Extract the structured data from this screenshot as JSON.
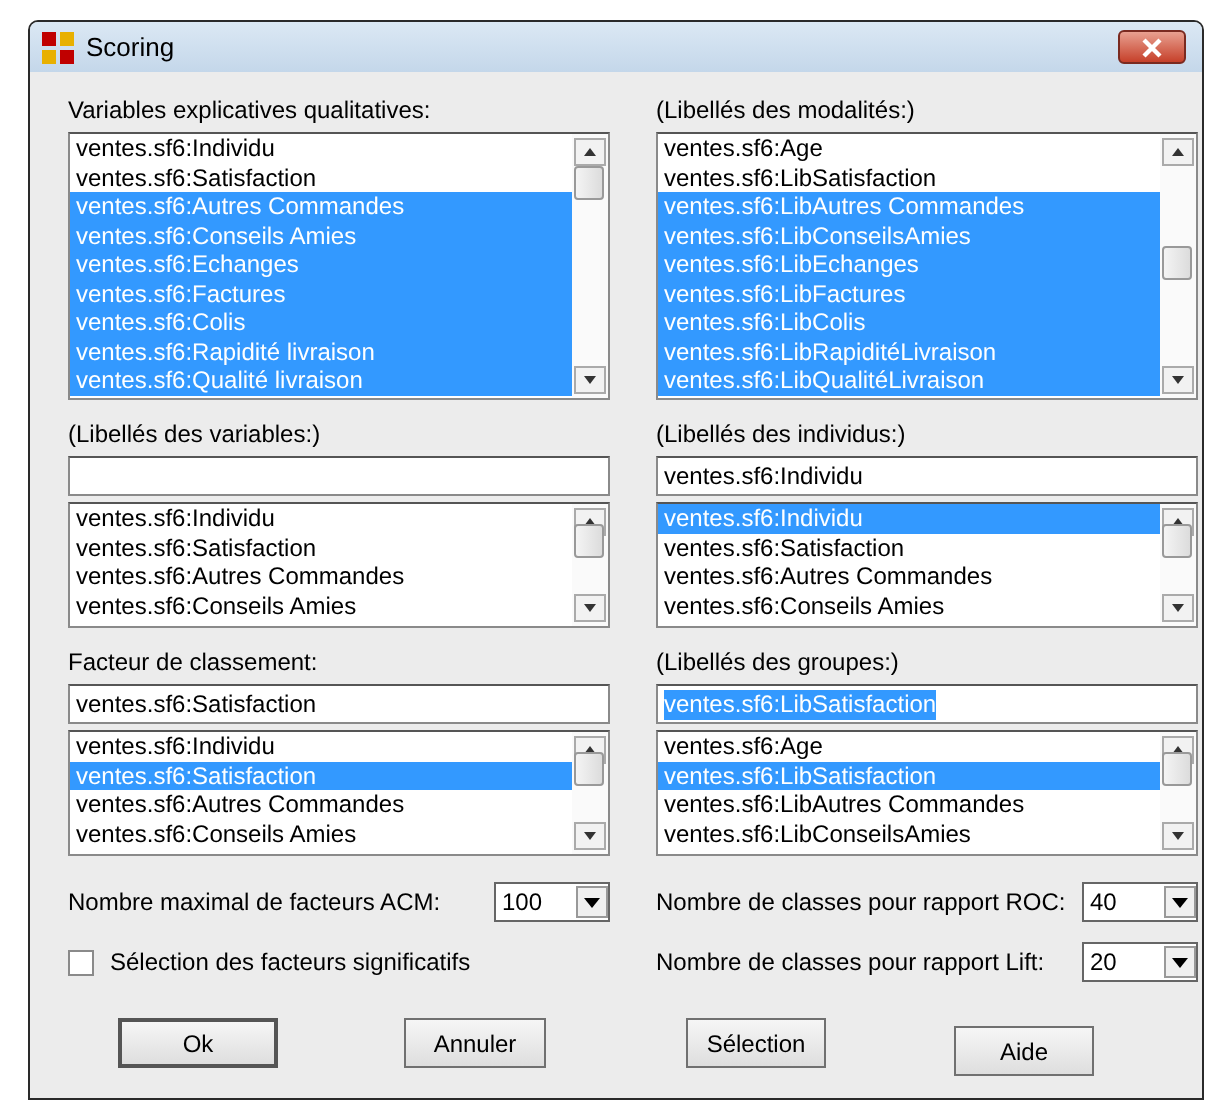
{
  "window": {
    "title": "Scoring"
  },
  "sections": [
    {
      "kind": "list",
      "label": "Variables explicatives qualitatives:",
      "items": [
        {
          "text": "ventes.sf6:Individu",
          "selected": false
        },
        {
          "text": "ventes.sf6:Satisfaction",
          "selected": false
        },
        {
          "text": "ventes.sf6:Autres Commandes",
          "selected": true
        },
        {
          "text": "ventes.sf6:Conseils Amies",
          "selected": true
        },
        {
          "text": "ventes.sf6:Echanges",
          "selected": true
        },
        {
          "text": "ventes.sf6:Factures",
          "selected": true
        },
        {
          "text": "ventes.sf6:Colis",
          "selected": true
        },
        {
          "text": "ventes.sf6:Rapidité livraison",
          "selected": true
        },
        {
          "text": "ventes.sf6:Qualité livraison",
          "selected": true
        }
      ]
    },
    {
      "kind": "list",
      "label": "(Libellés des modalités:)",
      "items": [
        {
          "text": "ventes.sf6:Age",
          "selected": false
        },
        {
          "text": "ventes.sf6:LibSatisfaction",
          "selected": false
        },
        {
          "text": "ventes.sf6:LibAutres Commandes",
          "selected": true
        },
        {
          "text": "ventes.sf6:LibConseilsAmies",
          "selected": true
        },
        {
          "text": "ventes.sf6:LibEchanges",
          "selected": true
        },
        {
          "text": "ventes.sf6:LibFactures",
          "selected": true
        },
        {
          "text": "ventes.sf6:LibColis",
          "selected": true
        },
        {
          "text": "ventes.sf6:LibRapiditéLivraison",
          "selected": true
        },
        {
          "text": "ventes.sf6:LibQualitéLivraison",
          "selected": true
        }
      ]
    },
    {
      "kind": "field-list",
      "label": "(Libellés des variables:)",
      "items": [
        {
          "text": "ventes.sf6:Individu",
          "selected": false
        },
        {
          "text": "ventes.sf6:Satisfaction",
          "selected": false
        },
        {
          "text": "ventes.sf6:Autres Commandes",
          "selected": false
        },
        {
          "text": "ventes.sf6:Conseils Amies",
          "selected": false
        }
      ]
    },
    {
      "kind": "field-list",
      "label": "(Libellés des individus:)",
      "field": {
        "value": "ventes.sf6:Individu",
        "value_selected": false
      },
      "items": [
        {
          "text": "ventes.sf6:Individu",
          "selected": true
        },
        {
          "text": "ventes.sf6:Satisfaction",
          "selected": false
        },
        {
          "text": "ventes.sf6:Autres Commandes",
          "selected": false
        },
        {
          "text": "ventes.sf6:Conseils Amies",
          "selected": false
        }
      ]
    },
    {
      "kind": "field-list",
      "label": "Facteur de classement:",
      "field": {
        "value": "ventes.sf6:Satisfaction",
        "value_selected": false
      },
      "items": [
        {
          "text": "ventes.sf6:Individu",
          "selected": false
        },
        {
          "text": "ventes.sf6:Satisfaction",
          "selected": true
        },
        {
          "text": "ventes.sf6:Autres Commandes",
          "selected": false
        },
        {
          "text": "ventes.sf6:Conseils Amies",
          "selected": false
        }
      ]
    },
    {
      "kind": "field-list",
      "label": "(Libellés des groupes:)",
      "field": {
        "value": "ventes.sf6:LibSatisfaction",
        "value_selected": true
      },
      "items": [
        {
          "text": "ventes.sf6:Age",
          "selected": false
        },
        {
          "text": "ventes.sf6:LibSatisfaction",
          "selected": true
        },
        {
          "text": "ventes.sf6:LibAutres Commandes",
          "selected": false
        },
        {
          "text": "ventes.sf6:LibConseilsAmies",
          "selected": false
        }
      ]
    }
  ],
  "options": [
    {
      "kind": "combo",
      "label": "Nombre maximal de facteurs ACM:",
      "value": "100"
    },
    {
      "kind": "combo",
      "label": "Nombre de classes pour rapport ROC:",
      "value": "40"
    },
    {
      "kind": "checkbox",
      "label": "Sélection des facteurs significatifs",
      "checked": false
    },
    {
      "kind": "combo",
      "label": "Nombre de classes pour rapport Lift:",
      "value": "20"
    }
  ],
  "buttons": [
    {
      "label": "Ok",
      "default": true
    },
    {
      "label": "Annuler",
      "default": false
    },
    {
      "label": "Sélection",
      "default": false
    },
    {
      "label": "Aide",
      "default": false
    }
  ]
}
